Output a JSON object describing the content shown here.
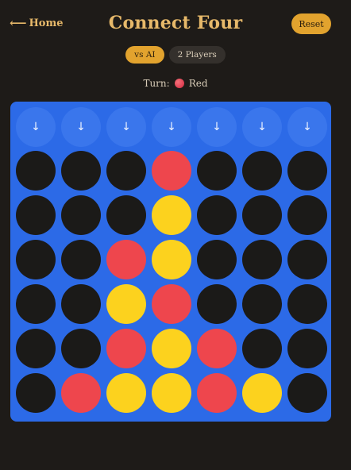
{
  "header": {
    "home_arrow": "⟵",
    "home_label": "Home",
    "title": "Connect Four",
    "reset_label": "Reset"
  },
  "modes": [
    {
      "label": "vs AI",
      "active": true
    },
    {
      "label": "2 Players",
      "active": false
    }
  ],
  "turn": {
    "label": "Turn:",
    "player": "Red",
    "color": "#e5364a"
  },
  "colors": {
    "board": "#2c6ae7",
    "empty": "#1b1a18",
    "red": "#ee464d",
    "yellow": "#fcd21e",
    "accent": "#e2a32e",
    "background": "#1e1b18"
  },
  "board": {
    "drop_arrow": "↓",
    "columns": 7,
    "rows": 6,
    "grid": [
      [
        "empty",
        "empty",
        "empty",
        "red",
        "empty",
        "empty",
        "empty"
      ],
      [
        "empty",
        "empty",
        "empty",
        "yellow",
        "empty",
        "empty",
        "empty"
      ],
      [
        "empty",
        "empty",
        "red",
        "yellow",
        "empty",
        "empty",
        "empty"
      ],
      [
        "empty",
        "empty",
        "yellow",
        "red",
        "empty",
        "empty",
        "empty"
      ],
      [
        "empty",
        "empty",
        "red",
        "yellow",
        "red",
        "empty",
        "empty"
      ],
      [
        "empty",
        "red",
        "yellow",
        "yellow",
        "red",
        "yellow",
        "empty"
      ]
    ]
  }
}
